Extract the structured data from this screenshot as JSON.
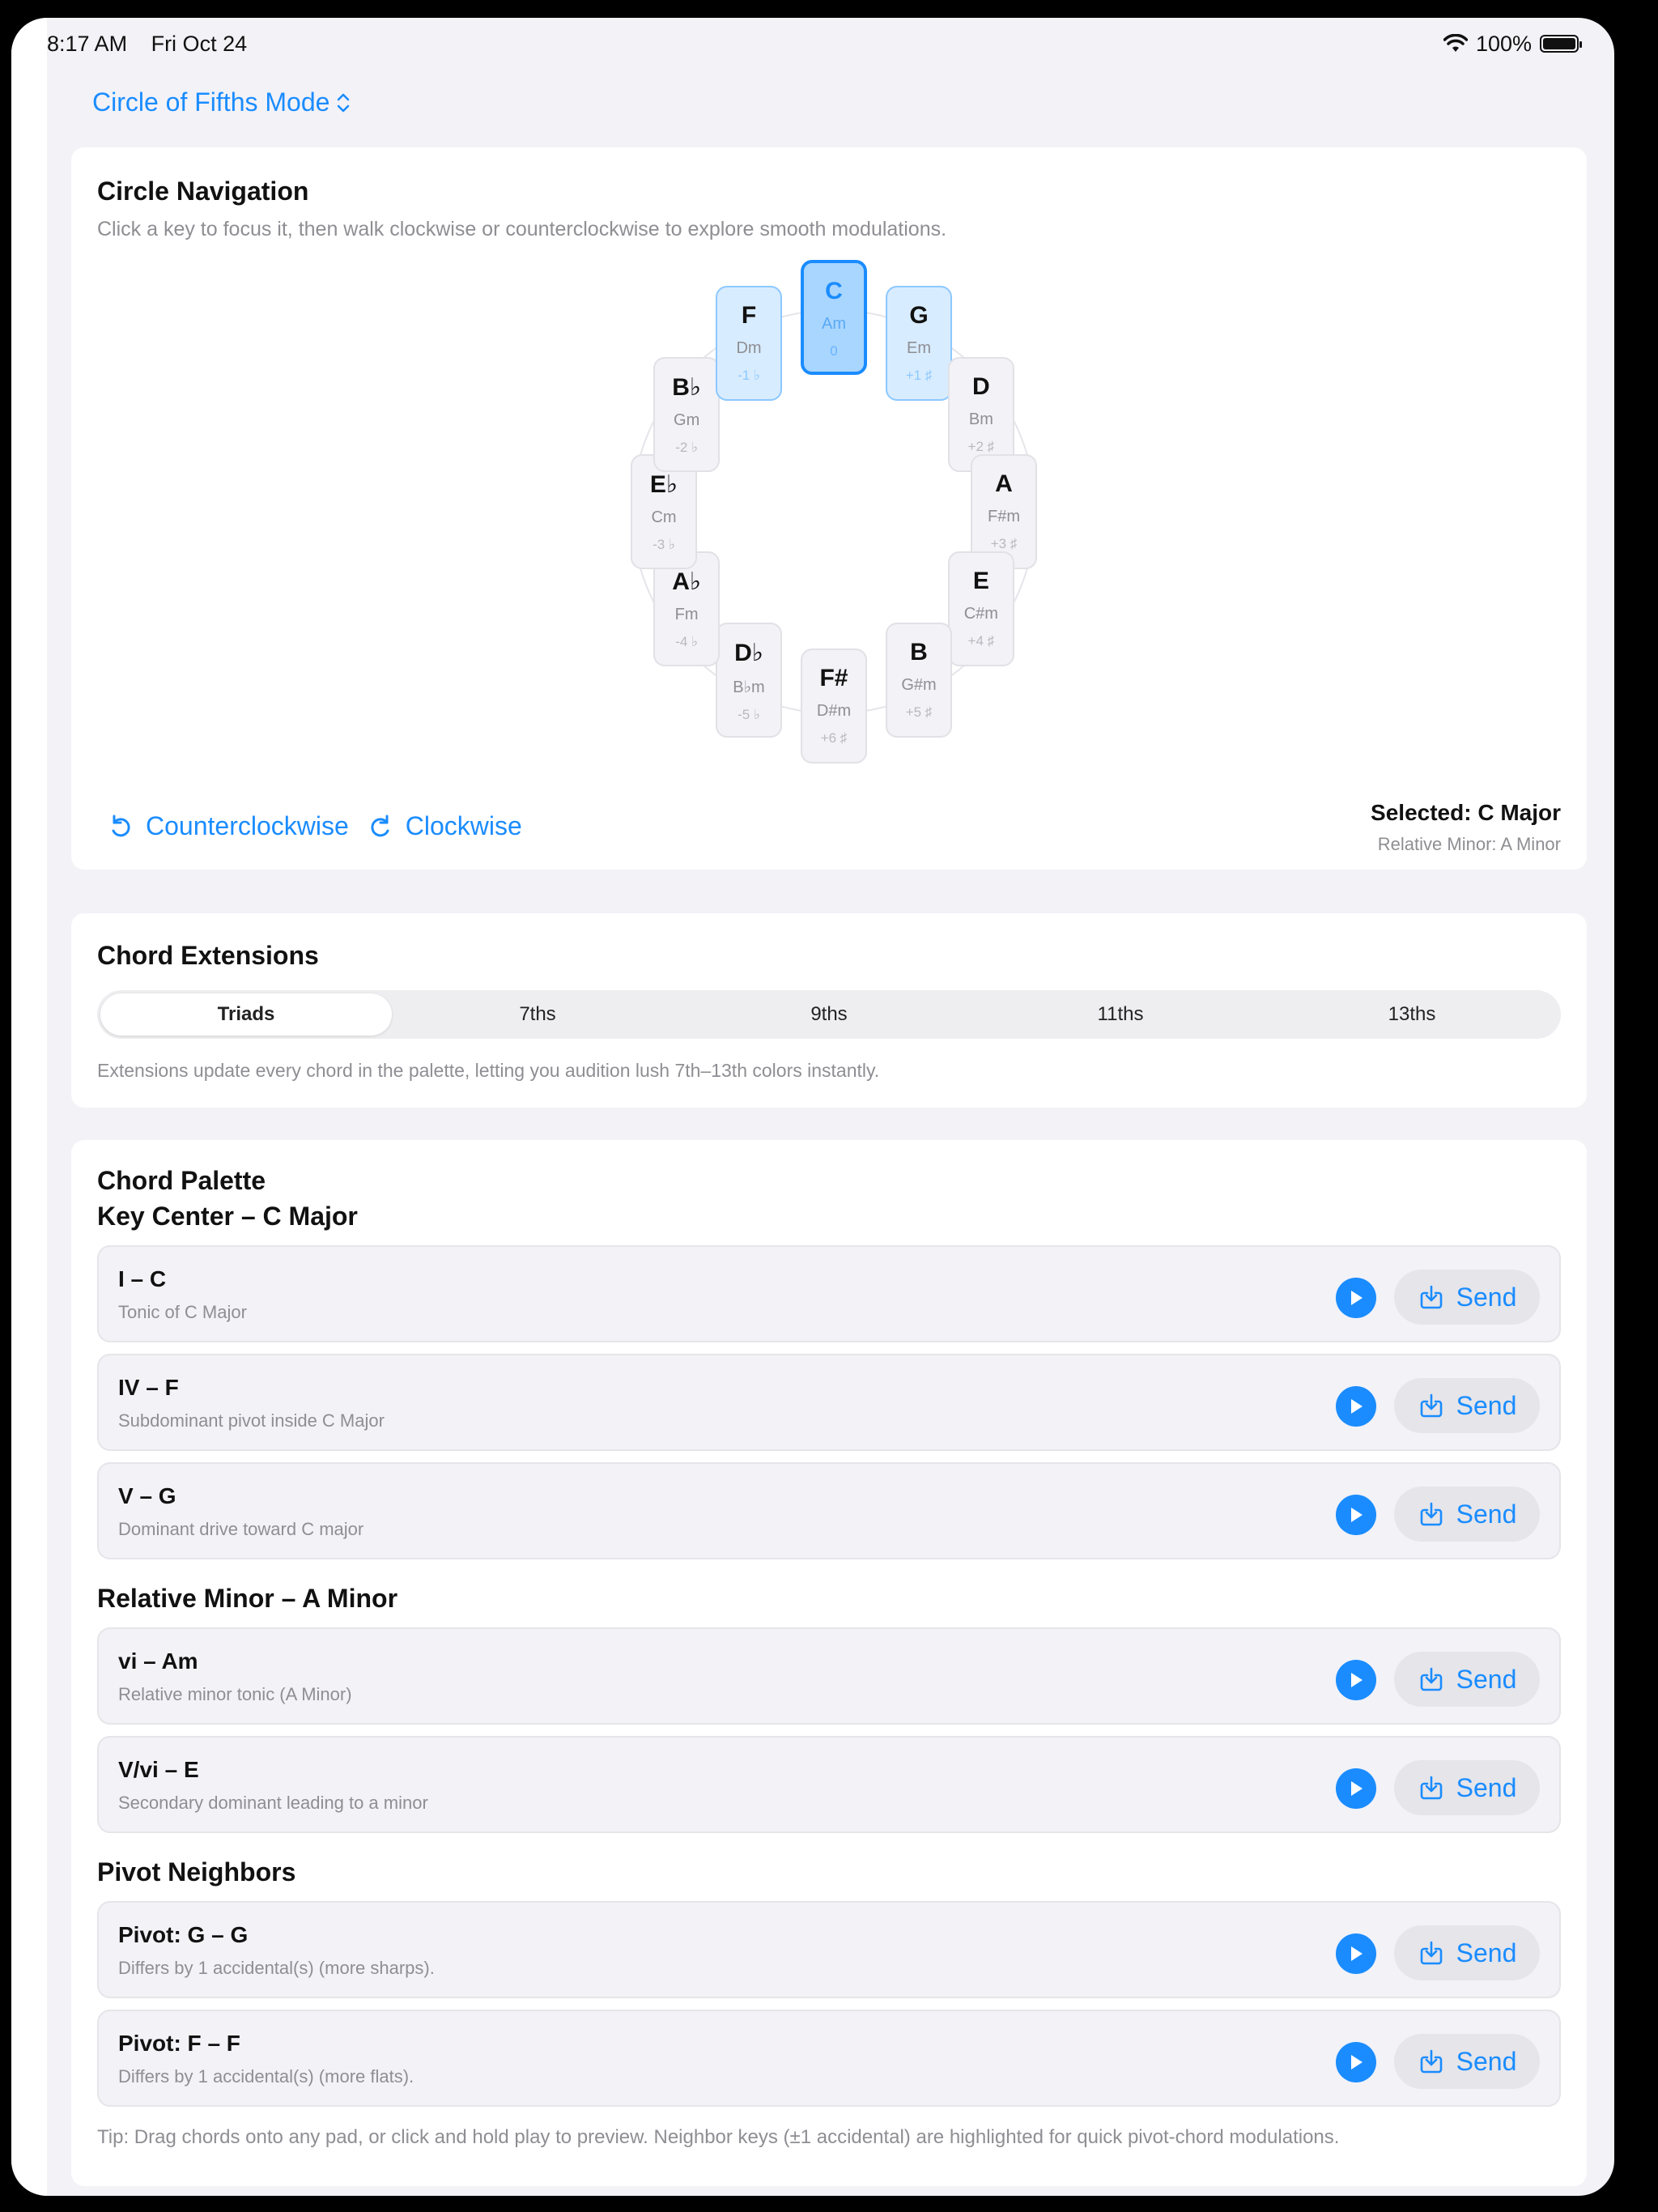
{
  "status_bar": {
    "time": "8:17 AM",
    "date": "Fri Oct 24",
    "battery": "100%"
  },
  "mode_switch": {
    "label": "Circle of Fifths Mode"
  },
  "circle_nav": {
    "title": "Circle Navigation",
    "subtitle": "Click a key to focus it, then walk clockwise or counterclockwise to explore smooth modulations.",
    "keys": [
      {
        "major": "C",
        "minor": "Am",
        "acc": "0",
        "state": "selected"
      },
      {
        "major": "G",
        "minor": "Em",
        "acc": "+1 ♯",
        "state": "neighbor"
      },
      {
        "major": "D",
        "minor": "Bm",
        "acc": "+2 ♯",
        "state": ""
      },
      {
        "major": "A",
        "minor": "F#m",
        "acc": "+3 ♯",
        "state": ""
      },
      {
        "major": "E",
        "minor": "C#m",
        "acc": "+4 ♯",
        "state": ""
      },
      {
        "major": "B",
        "minor": "G#m",
        "acc": "+5 ♯",
        "state": ""
      },
      {
        "major": "F#",
        "minor": "D#m",
        "acc": "+6 ♯",
        "state": ""
      },
      {
        "major": "D♭",
        "minor": "B♭m",
        "acc": "-5 ♭",
        "state": ""
      },
      {
        "major": "A♭",
        "minor": "Fm",
        "acc": "-4 ♭",
        "state": ""
      },
      {
        "major": "E♭",
        "minor": "Cm",
        "acc": "-3 ♭",
        "state": ""
      },
      {
        "major": "B♭",
        "minor": "Gm",
        "acc": "-2 ♭",
        "state": ""
      },
      {
        "major": "F",
        "minor": "Dm",
        "acc": "-1 ♭",
        "state": "neighbor"
      }
    ],
    "counterclockwise_label": "Counterclockwise",
    "clockwise_label": "Clockwise",
    "selected_label": "Selected: C Major",
    "relative_label": "Relative Minor: A Minor"
  },
  "extensions": {
    "title": "Chord Extensions",
    "options": [
      "Triads",
      "7ths",
      "9ths",
      "11ths",
      "13ths"
    ],
    "active_index": 0,
    "note": "Extensions update every chord in the palette, letting you audition lush 7th–13th colors instantly."
  },
  "palette": {
    "title": "Chord Palette",
    "send_label": "Send",
    "sections": [
      {
        "title": "Key Center – C Major",
        "rows": [
          {
            "title": "I – C",
            "sub": "Tonic of C Major"
          },
          {
            "title": "IV – F",
            "sub": "Subdominant pivot inside C Major"
          },
          {
            "title": "V – G",
            "sub": "Dominant drive toward C major"
          }
        ]
      },
      {
        "title": "Relative Minor – A Minor",
        "rows": [
          {
            "title": "vi – Am",
            "sub": "Relative minor tonic (A Minor)"
          },
          {
            "title": "V/vi – E",
            "sub": "Secondary dominant leading to a minor"
          }
        ]
      },
      {
        "title": "Pivot Neighbors",
        "rows": [
          {
            "title": "Pivot: G – G",
            "sub": "Differs by 1 accidental(s) (more sharps)."
          },
          {
            "title": "Pivot: F – F",
            "sub": "Differs by 1 accidental(s) (more flats)."
          }
        ]
      }
    ],
    "tip": "Tip: Drag chords onto any pad, or click and hold play to preview. Neighbor keys (±1 accidental) are highlighted for quick pivot-chord modulations."
  },
  "colors": {
    "accent": "#1a8cff",
    "background": "#f2f2f7",
    "card": "#ffffff"
  }
}
